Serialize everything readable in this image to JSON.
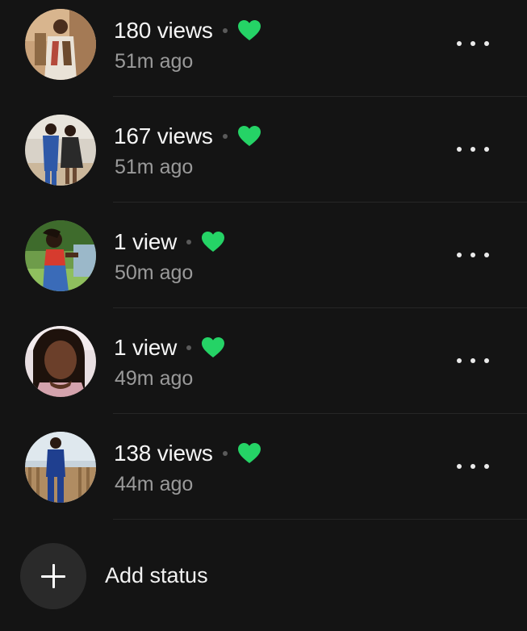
{
  "colors": {
    "background": "#141414",
    "accent_green": "#25D366",
    "secondary_text": "#9a9a9a"
  },
  "statuses": [
    {
      "views": "180 views",
      "time": "51m ago",
      "reaction_icon": "green-heart-icon",
      "avatar_icon": "avatar-photo"
    },
    {
      "views": "167 views",
      "time": "51m ago",
      "reaction_icon": "green-heart-icon",
      "avatar_icon": "avatar-photo"
    },
    {
      "views": "1 view",
      "time": "50m ago",
      "reaction_icon": "green-heart-icon",
      "avatar_icon": "avatar-photo"
    },
    {
      "views": "1 view",
      "time": "49m ago",
      "reaction_icon": "green-heart-icon",
      "avatar_icon": "avatar-photo"
    },
    {
      "views": "138 views",
      "time": "44m ago",
      "reaction_icon": "green-heart-icon",
      "avatar_icon": "avatar-photo"
    }
  ],
  "add_status": {
    "label": "Add status",
    "icon": "plus-icon"
  }
}
